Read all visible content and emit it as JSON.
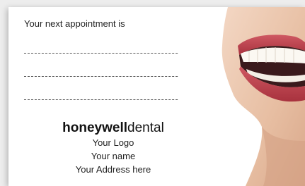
{
  "card": {
    "heading": "Your next appointment is",
    "brand_bold": "honeywell",
    "brand_light": "dental",
    "logo_placeholder": "Your Logo",
    "name_placeholder": "Your name",
    "address_placeholder": "Your Address here"
  },
  "colors": {
    "background": "#ededed",
    "card": "#ffffff",
    "text": "#222222",
    "lip": "#c2434f",
    "skin": "#e8c2a6"
  },
  "icons": {
    "photo": "smiling-mouth-photo"
  }
}
